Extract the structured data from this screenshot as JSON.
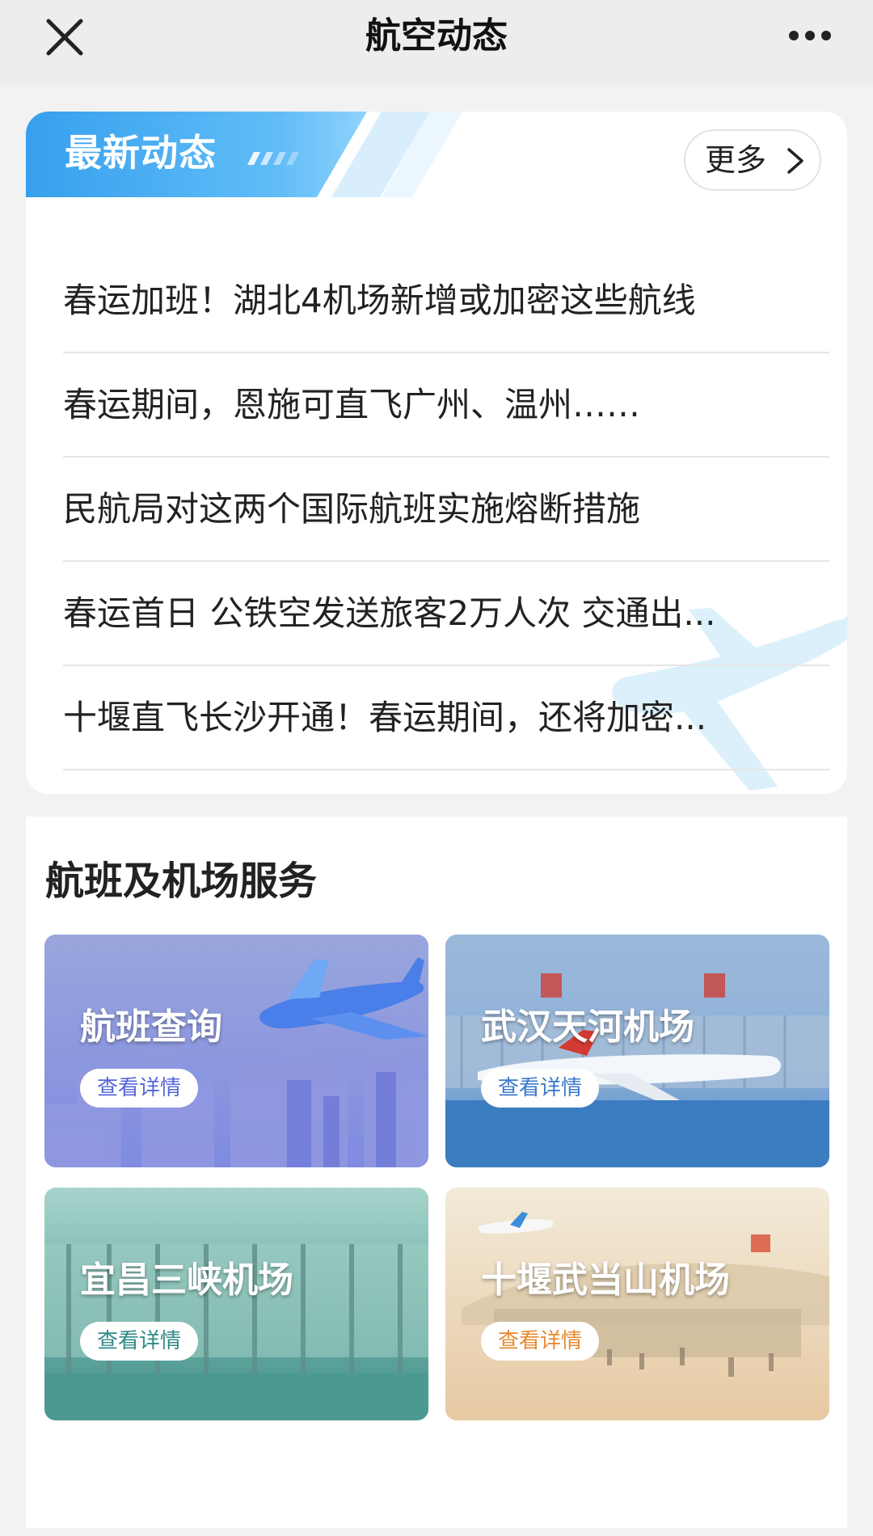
{
  "header": {
    "title": "航空动态",
    "close_icon": "close-icon",
    "more_icon": "more-dots-icon"
  },
  "news": {
    "heading": "最新动态",
    "more_label": "更多",
    "items": [
      "春运加班！湖北4机场新增或加密这些航线",
      "春运期间，恩施可直飞广州、温州……",
      "民航局对这两个国际航班实施熔断措施",
      "春运首日 公铁空发送旅客2万人次 交通出...",
      "十堰直飞长沙开通！春运期间，还将加密..."
    ]
  },
  "services": {
    "title": "航班及机场服务",
    "tiles": [
      {
        "title": "航班查询",
        "button": "查看详情",
        "accent": "#5566d6"
      },
      {
        "title": "武汉天河机场",
        "button": "查看详情",
        "accent": "#3a78c9"
      },
      {
        "title": "宜昌三峡机场",
        "button": "查看详情",
        "accent": "#2f8a86"
      },
      {
        "title": "十堰武当山机场",
        "button": "查看详情",
        "accent": "#e8892f"
      }
    ]
  },
  "colors": {
    "banner_blue": "#35a2f0",
    "divider": "#e6e6e6",
    "page_bg": "#f2f2f2"
  }
}
